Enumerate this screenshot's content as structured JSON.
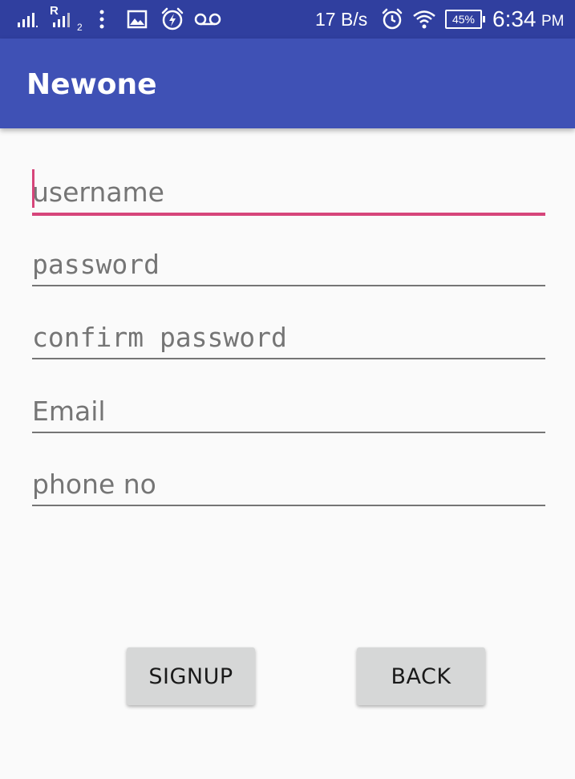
{
  "status_bar": {
    "carrier_label": "R",
    "sim_index": "2",
    "network_speed": "17 B/s",
    "battery_percent": "45%",
    "time": "6:34",
    "ampm": "PM",
    "icons": [
      "signal-icon",
      "signal-r-icon",
      "more-icon",
      "image-icon",
      "alarm-flash-icon",
      "voicemail-icon",
      "clock-icon",
      "wifi-icon",
      "battery-icon"
    ]
  },
  "app_bar": {
    "title": "Newone",
    "color": "#3f51b5"
  },
  "form": {
    "username": {
      "placeholder": "username",
      "value": ""
    },
    "password": {
      "placeholder": "password",
      "value": ""
    },
    "confirm_password": {
      "placeholder": "confirm password",
      "value": ""
    },
    "email": {
      "placeholder": "Email",
      "value": ""
    },
    "phone": {
      "placeholder": "phone no",
      "value": ""
    },
    "accent_color": "#d6457a"
  },
  "buttons": {
    "signup_label": "SIGNUP",
    "back_label": "BACK"
  }
}
